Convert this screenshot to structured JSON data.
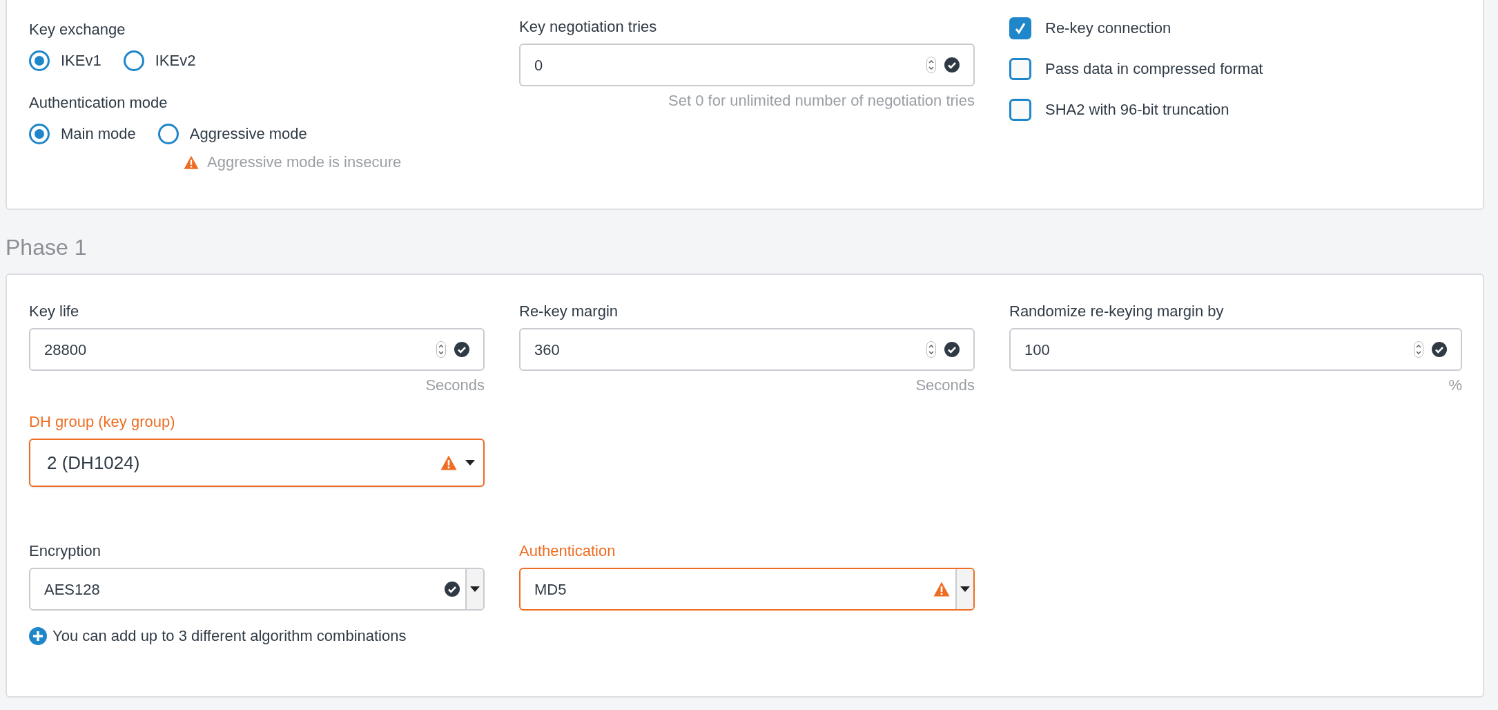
{
  "connection": {
    "key_exchange": {
      "label": "Key exchange",
      "options": [
        {
          "label": "IKEv1",
          "selected": true
        },
        {
          "label": "IKEv2",
          "selected": false
        }
      ]
    },
    "authentication_mode": {
      "label": "Authentication mode",
      "options": [
        {
          "label": "Main mode",
          "selected": true
        },
        {
          "label": "Aggressive mode",
          "selected": false
        }
      ],
      "warning": "Aggressive mode is insecure"
    },
    "key_negotiation_tries": {
      "label": "Key negotiation tries",
      "value": "0",
      "invalid": false,
      "hint": "Set 0 for unlimited number of negotiation tries"
    },
    "checkboxes": [
      {
        "label": "Re-key connection",
        "checked": true
      },
      {
        "label": "Pass data in compressed format",
        "checked": false
      },
      {
        "label": "SHA2 with 96-bit truncation",
        "checked": false
      }
    ]
  },
  "phase1": {
    "title": "Phase 1",
    "number_fields": [
      {
        "label": "Key life",
        "value": "28800",
        "invalid": false,
        "unit": "Seconds"
      },
      {
        "label": "Re-key margin",
        "value": "360",
        "invalid": false,
        "unit": "Seconds"
      },
      {
        "label": "Randomize re-keying margin by",
        "value": "100",
        "invalid": false,
        "unit": "%"
      }
    ],
    "dh_group": {
      "label": "DH group (key group)",
      "value": "2 (DH1024)",
      "invalid": true
    },
    "algorithms": [
      {
        "label": "Encryption",
        "value": "AES128",
        "invalid": false
      },
      {
        "label": "Authentication",
        "value": "MD5",
        "invalid": true
      }
    ],
    "add_note": "You can add up to 3 different algorithm combinations"
  }
}
